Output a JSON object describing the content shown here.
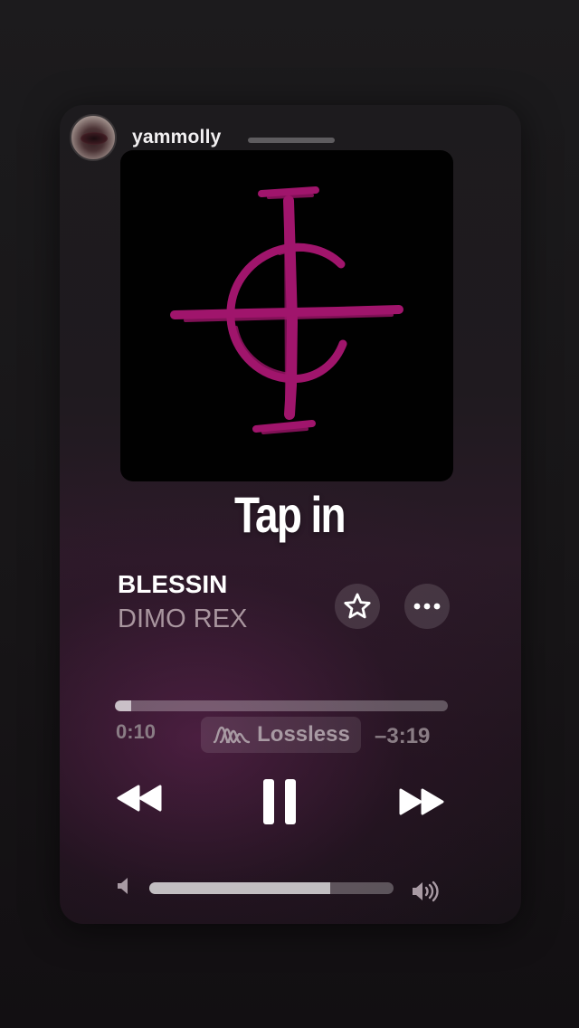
{
  "story": {
    "username": "yammolly"
  },
  "sticker": {
    "text": "Tap in"
  },
  "now_playing": {
    "title": "BLESSIN",
    "artist": "DIMO REX",
    "elapsed": "0:10",
    "remaining": "–3:19",
    "progress_fraction": 0.05,
    "quality_label": "Lossless",
    "volume_fraction": 0.74
  },
  "icons": {
    "favorite": "star-icon",
    "more": "ellipsis-icon",
    "rewind": "rewind-icon",
    "pause": "pause-icon",
    "forward": "fast-forward-icon",
    "lossless": "lossless-wave-icon",
    "volume_low": "speaker-low-icon",
    "volume_high": "speaker-high-icon"
  },
  "colors": {
    "artwork_symbol": "#a0156c",
    "artist_text": "#a9969f",
    "time_text": "#8a7d85"
  }
}
